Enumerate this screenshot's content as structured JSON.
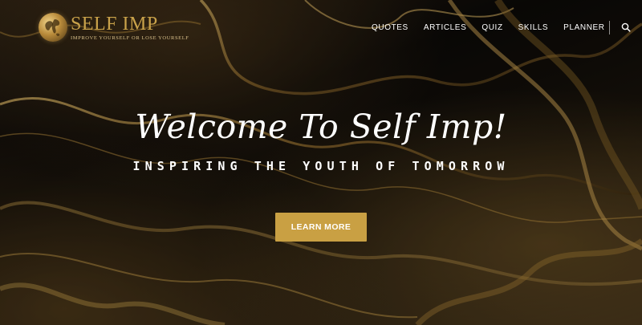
{
  "brand": {
    "name": "SELF IMP",
    "tagline": "IMPROVE YOURSELF OR LOSE YOURSELF",
    "logo_icon": "globe-icon",
    "color": "#c9a24a"
  },
  "nav": {
    "items": [
      {
        "label": "QUOTES"
      },
      {
        "label": "ARTICLES"
      },
      {
        "label": "QUIZ"
      },
      {
        "label": "SKILLS"
      },
      {
        "label": "PLANNER"
      }
    ],
    "search_icon": "search-icon"
  },
  "hero": {
    "title": "Welcome To Self Imp!",
    "subtitle": "INSPIRING THE YOUTH OF TOMORROW",
    "cta_label": "LEARN MORE",
    "cta_color": "#c9a043"
  }
}
